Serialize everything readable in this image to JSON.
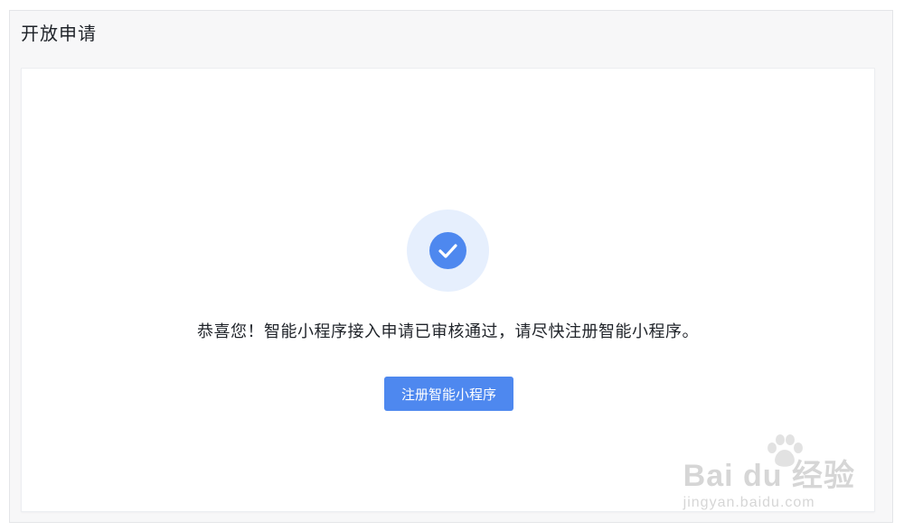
{
  "header": {
    "title": "开放申请"
  },
  "result": {
    "icon": "check-circle-icon",
    "message": "恭喜您！智能小程序接入申请已审核通过，请尽快注册智能小程序。",
    "button_label": "注册智能小程序"
  },
  "watermark": {
    "brand": "Bai du 经验",
    "url": "jingyan.baidu.com"
  },
  "colors": {
    "accent": "#4e88ef",
    "accent_light": "#e6effd",
    "text": "#1f2329",
    "frame_bg": "#f7f7f8"
  }
}
